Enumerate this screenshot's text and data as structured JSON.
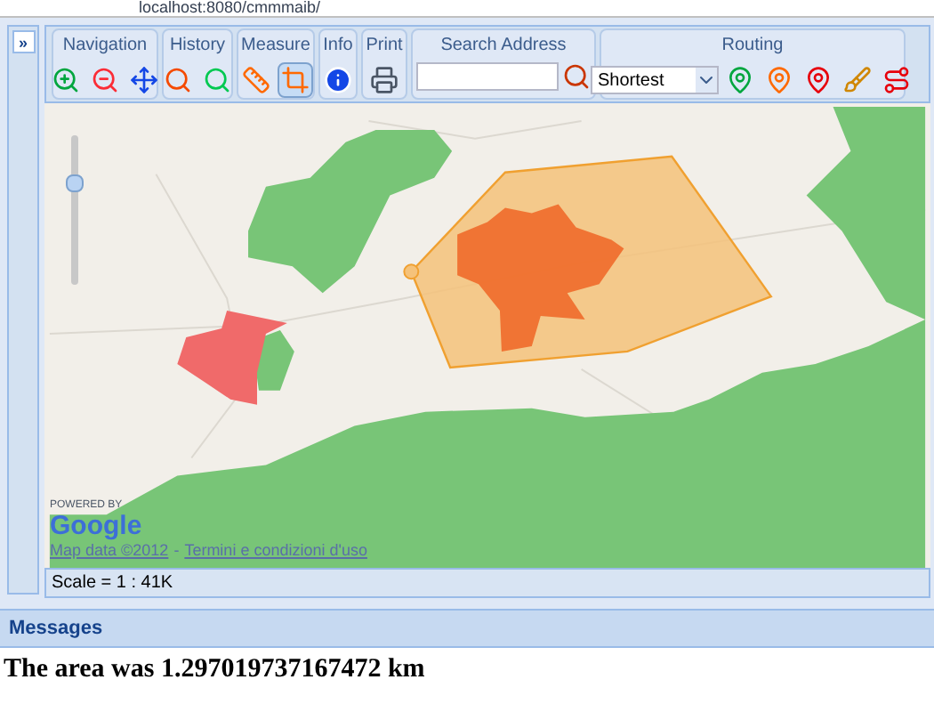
{
  "browser": {
    "address": "localhost:8080/cmmmaib/"
  },
  "side_panel": {
    "expand_label": "»"
  },
  "toolbar": {
    "groups": [
      {
        "title": "Navigation",
        "tools": [
          {
            "kind": "zoom-in",
            "selected": false
          },
          {
            "kind": "zoom-out",
            "selected": false
          },
          {
            "kind": "pan",
            "selected": false
          }
        ]
      },
      {
        "title": "History",
        "tools": [
          {
            "kind": "previous",
            "selected": false
          },
          {
            "kind": "next",
            "selected": false
          }
        ]
      },
      {
        "title": "Measure",
        "tools": [
          {
            "kind": "line",
            "selected": false
          },
          {
            "kind": "area",
            "selected": true
          }
        ]
      },
      {
        "title": "Info",
        "tools": [
          {
            "kind": "info",
            "selected": false
          }
        ]
      },
      {
        "title": "Print",
        "tools": [
          {
            "kind": "print",
            "selected": false
          }
        ]
      }
    ],
    "search": {
      "title": "Search Address"
    },
    "routing": {
      "title": "Routing",
      "mode": "Shortest",
      "tools": [
        {
          "kind": "start",
          "selected": false
        },
        {
          "kind": "via",
          "selected": false
        },
        {
          "kind": "end",
          "selected": false
        },
        {
          "kind": "clear",
          "selected": false
        },
        {
          "kind": "route",
          "selected": false
        }
      ]
    }
  },
  "map": {
    "zoom": {
      "level": 0.7
    },
    "powered_by": "POWERED BY",
    "logo": "Google",
    "attribution": {
      "data": "Map data ©2012",
      "separator": "-",
      "terms": "Termini e condizioni d'uso"
    }
  },
  "status_bar": {
    "scale": "Scale = 1 : 41K"
  },
  "messages": {
    "title": "Messages",
    "text": "The area was 1.297019737167472 km"
  }
}
